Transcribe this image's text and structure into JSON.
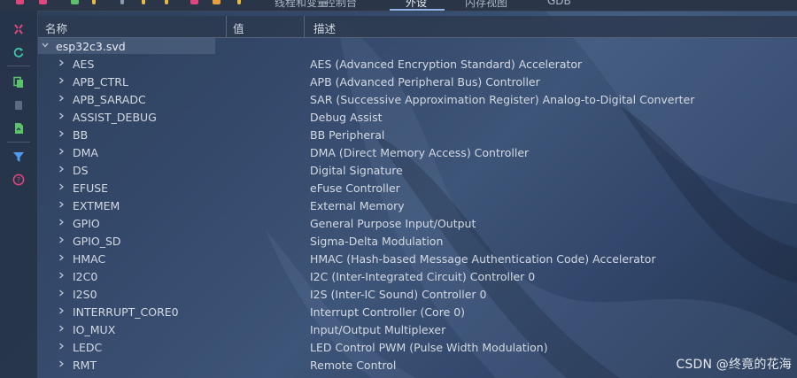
{
  "topbar": {
    "tabs": [
      {
        "label": "线程和变量",
        "active": false
      },
      {
        "label": "控制台",
        "active": false
      },
      {
        "label": "外设",
        "active": true
      },
      {
        "label": "内存视图",
        "active": false
      },
      {
        "label": "GDB",
        "active": false
      }
    ]
  },
  "leftbar": {
    "icons": [
      "disconnect-icon",
      "refresh-icon",
      "copy-icon",
      "record-icon",
      "export-icon",
      "filter-icon",
      "help-icon"
    ]
  },
  "table": {
    "columns": [
      "名称",
      "值",
      "描述"
    ],
    "root": {
      "name": "esp32c3.svd",
      "expanded": true
    },
    "rows": [
      {
        "name": "AES",
        "desc": "AES (Advanced Encryption Standard) Accelerator"
      },
      {
        "name": "APB_CTRL",
        "desc": "APB (Advanced Peripheral Bus) Controller"
      },
      {
        "name": "APB_SARADC",
        "desc": "SAR (Successive Approximation Register) Analog-to-Digital Converter"
      },
      {
        "name": "ASSIST_DEBUG",
        "desc": "Debug Assist"
      },
      {
        "name": "BB",
        "desc": "BB Peripheral"
      },
      {
        "name": "DMA",
        "desc": "DMA (Direct Memory Access) Controller"
      },
      {
        "name": "DS",
        "desc": "Digital Signature"
      },
      {
        "name": "EFUSE",
        "desc": "eFuse Controller"
      },
      {
        "name": "EXTMEM",
        "desc": "External Memory"
      },
      {
        "name": "GPIO",
        "desc": "General Purpose Input/Output"
      },
      {
        "name": "GPIO_SD",
        "desc": "Sigma-Delta Modulation"
      },
      {
        "name": "HMAC",
        "desc": "HMAC (Hash-based Message Authentication Code) Accelerator"
      },
      {
        "name": "I2C0",
        "desc": "I2C (Inter-Integrated Circuit) Controller 0"
      },
      {
        "name": "I2S0",
        "desc": "I2S (Inter-IC Sound) Controller 0"
      },
      {
        "name": "INTERRUPT_CORE0",
        "desc": "Interrupt Controller (Core 0)"
      },
      {
        "name": "IO_MUX",
        "desc": "Input/Output Multiplexer"
      },
      {
        "name": "LEDC",
        "desc": "LED Control PWM (Pulse Width Modulation)"
      },
      {
        "name": "RMT",
        "desc": "Remote Control"
      }
    ]
  },
  "watermark": "CSDN @终竟的花海",
  "colors": {
    "accent": "#8fb3e8",
    "danger": "#e0457b",
    "teal": "#3fc1a9",
    "green": "#5cc36a",
    "blue": "#4e9bf0"
  }
}
